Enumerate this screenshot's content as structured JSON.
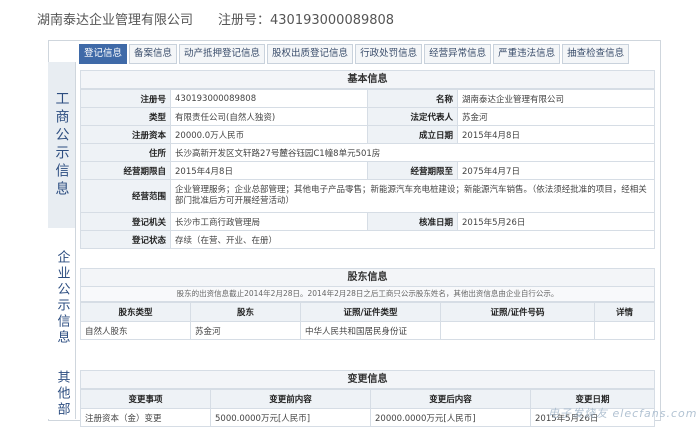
{
  "header": {
    "company_name": "湖南泰达企业管理有限公司",
    "reg_label": "注册号：430193000089808"
  },
  "side": {
    "section1": "工商公示信息",
    "section2": "企业公示信息",
    "section3": "其他部"
  },
  "tabs": [
    {
      "label": "登记信息",
      "active": true
    },
    {
      "label": "备案信息"
    },
    {
      "label": "动产抵押登记信息"
    },
    {
      "label": "股权出质登记信息"
    },
    {
      "label": "行政处罚信息"
    },
    {
      "label": "经营异常信息"
    },
    {
      "label": "严重违法信息"
    },
    {
      "label": "抽查检查信息"
    }
  ],
  "basic": {
    "title": "基本信息",
    "reg_no_label": "注册号",
    "reg_no_value": "430193000089808",
    "name_label": "名称",
    "name_value": "湖南泰达企业管理有限公司",
    "type_label": "类型",
    "type_value": "有限责任公司(自然人独资)",
    "legal_label": "法定代表人",
    "legal_value": "苏金河",
    "capital_label": "注册资本",
    "capital_value": "20000.0万人民币",
    "found_label": "成立日期",
    "found_value": "2015年4月8日",
    "address_label": "住所",
    "address_value": "长沙高新开发区文轩路27号麓谷钰园C1幢8单元501房",
    "from_label": "经营期限自",
    "from_value": "2015年4月8日",
    "to_label": "经营期限至",
    "to_value": "2075年4月7日",
    "scope_label": "经营范围",
    "scope_value": "企业管理服务；企业总部管理；其他电子产品零售；新能源汽车充电桩建设；新能源汽车销售。（依法须经批准的项目，经相关部门批准后方可开展经营活动）",
    "authority_label": "登记机关",
    "authority_value": "长沙市工商行政管理局",
    "approve_label": "核准日期",
    "approve_value": "2015年5月26日",
    "status_label": "登记状态",
    "status_value": "存续（在营、开业、在册）"
  },
  "shareholders": {
    "title": "股东信息",
    "note": "股东的出资信息截止2014年2月28日。2014年2月28日之后工商只公示股东姓名，其他出资信息由企业自行公示。",
    "headers": [
      "股东类型",
      "股东",
      "证照/证件类型",
      "证照/证件号码",
      "详情"
    ],
    "rows": [
      [
        "自然人股东",
        "苏金河",
        "中华人民共和国居民身份证",
        "",
        ""
      ]
    ]
  },
  "changes": {
    "title": "变更信息",
    "headers": [
      "变更事项",
      "变更前内容",
      "变更后内容",
      "变更日期"
    ],
    "rows": [
      [
        "注册资本（金）变更",
        "5000.0000万元[人民币]",
        "20000.0000万元[人民币]",
        "2015年5月26日"
      ]
    ]
  },
  "watermark": "电子发烧友 elecfans.com"
}
